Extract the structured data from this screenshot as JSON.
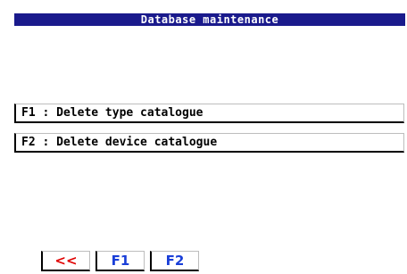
{
  "window": {
    "title": "Database maintenance"
  },
  "menu": {
    "items": [
      {
        "key": "F1",
        "label": "F1 : Delete type catalogue"
      },
      {
        "key": "F2",
        "label": "F2 : Delete device catalogue"
      }
    ]
  },
  "function_keys": {
    "back_label": "<<",
    "f1_label": "F1",
    "f2_label": "F2"
  },
  "colors": {
    "title_bar": "#1a1a8c",
    "back_key": "#e00000",
    "function_key": "#1a3fd8"
  }
}
